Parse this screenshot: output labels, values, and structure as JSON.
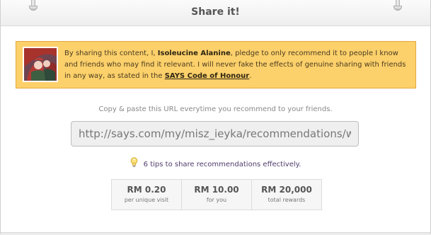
{
  "dialog": {
    "title": "Share it!"
  },
  "pledge": {
    "text_before": "By sharing this content, I, ",
    "user_name": "Isoleucine Alanine",
    "text_after": ", pledge to only recommend it to people I know and friends who may find it relevant. I will never fake the effects of genuine sharing with friends in any way, as stated in the ",
    "link_label": "SAYS Code of Honour",
    "text_end": ".",
    "background_color": "#fcd06a",
    "border_color": "#e2a93d"
  },
  "share": {
    "instruction": "Copy & paste this URL everytime you recommend to your friends.",
    "url": "http://says.com/my/misz_ieyka/recommendations/ww"
  },
  "tips": {
    "icon": "lightbulb-icon",
    "label": "6 tips to share recommendations effectively."
  },
  "stats": [
    {
      "amount": "RM 0.20",
      "caption": "per unique visit"
    },
    {
      "amount": "RM 10.00",
      "caption": "for you"
    },
    {
      "amount": "RM 20,000",
      "caption": "total rewards"
    }
  ]
}
